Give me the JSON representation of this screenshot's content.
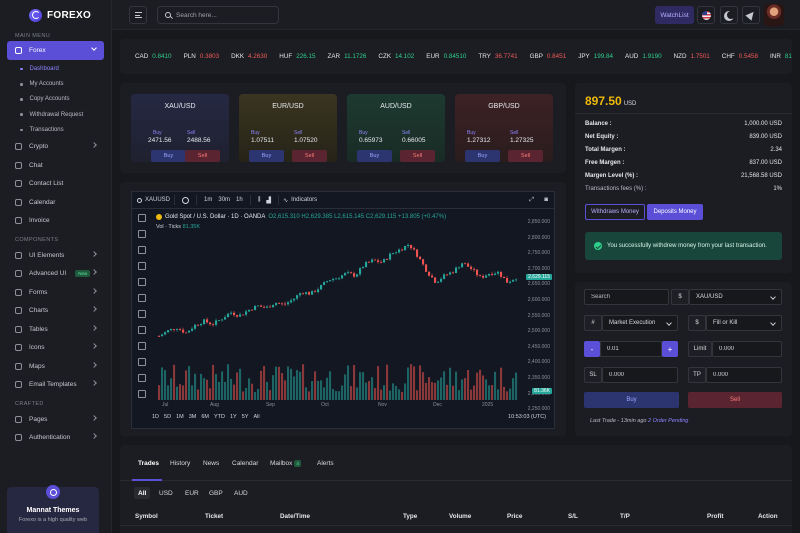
{
  "app": {
    "name": "FOREXO"
  },
  "header": {
    "search_placeholder": "Search here...",
    "watchlist_label": "WatchList"
  },
  "sidebar": {
    "main_menu_heading": "MAIN MENU",
    "forex_label": "Forex",
    "forex_sub": [
      "Dashboard",
      "My Accounts",
      "Copy Accounts",
      "Withdrawal Request",
      "Transactions"
    ],
    "crypto_label": "Crypto",
    "chat_label": "Chat",
    "contact_label": "Contact List",
    "calendar_label": "Calendar",
    "invoice_label": "Invoice",
    "components_heading": "COMPONENTS",
    "components": [
      "UI Elements",
      "Advanced UI",
      "Forms",
      "Charts",
      "Tables",
      "Icons",
      "Maps",
      "Email Templates"
    ],
    "new_badge": "New",
    "crafted_heading": "CRAFTED",
    "pages_label": "Pages",
    "auth_label": "Authentication",
    "promo_title": "Mannat Themes",
    "promo_text": "Forexo is a high quality web"
  },
  "ticker": [
    {
      "sym": "CAD",
      "val": "0.8410",
      "dir": "up"
    },
    {
      "sym": "PLN",
      "val": "0.3803",
      "dir": "down"
    },
    {
      "sym": "DKK",
      "val": "4.2630",
      "dir": "down"
    },
    {
      "sym": "HUF",
      "val": "226.15",
      "dir": "up"
    },
    {
      "sym": "ZAR",
      "val": "11.1726",
      "dir": "up"
    },
    {
      "sym": "CZK",
      "val": "14.102",
      "dir": "up"
    },
    {
      "sym": "EUR",
      "val": "0.84510",
      "dir": "up"
    },
    {
      "sym": "TRY",
      "val": "36.7741",
      "dir": "down"
    },
    {
      "sym": "GBP",
      "val": "0.8451",
      "dir": "down"
    },
    {
      "sym": "JPY",
      "val": "199.84",
      "dir": "up"
    },
    {
      "sym": "AUD",
      "val": "1.9190",
      "dir": "up"
    },
    {
      "sym": "NZD",
      "val": "1.7501",
      "dir": "down"
    },
    {
      "sym": "CHF",
      "val": "0.5458",
      "dir": "down"
    },
    {
      "sym": "INR",
      "val": "81.",
      "dir": "up"
    }
  ],
  "pairs": [
    {
      "name": "XAU/USD",
      "buy_label": "Buy",
      "sell_label": "Sell",
      "buy": "2471.56",
      "sell": "2488.56",
      "buy_btn": "Buy",
      "sell_btn": "Sell"
    },
    {
      "name": "EUR/USD",
      "buy_label": "Buy",
      "sell_label": "Sell",
      "buy": "1.07511",
      "sell": "1.07520",
      "buy_btn": "Buy",
      "sell_btn": "Sell"
    },
    {
      "name": "AUD/USD",
      "buy_label": "Buy",
      "sell_label": "Sell",
      "buy": "0.65973",
      "sell": "0.66005",
      "buy_btn": "Buy",
      "sell_btn": "Sell"
    },
    {
      "name": "GBP/USD",
      "buy_label": "Buy",
      "sell_label": "Sell",
      "buy": "1.27312",
      "sell": "1.27325",
      "buy_btn": "Buy",
      "sell_btn": "Sell"
    }
  ],
  "chart": {
    "symbol": "XAUUSD",
    "timeframes": [
      "1m",
      "30m",
      "1h"
    ],
    "indicators_label": "Indicators",
    "title": "Gold Spot / U.S. Dollar · 1D · OANDA",
    "ohlc": "O2,615.310 H2,629.385 L2,615.145 C2,629.115 +13.805 (+0.47%)",
    "vol_label": "Vol · Ticks",
    "vol_value": "81.35K",
    "ranges": [
      "1D",
      "5D",
      "1M",
      "3M",
      "6M",
      "YTD",
      "1Y",
      "5Y",
      "All"
    ],
    "time": "10:53:03 (UTC)",
    "months": [
      "Jul",
      "Aug",
      "Sep",
      "Oct",
      "Nov",
      "Dec",
      "2025"
    ],
    "price_ticks": [
      "2,850.000",
      "2,800.000",
      "2,750.000",
      "2,700.000",
      "2,650.000",
      "2,600.000",
      "2,550.000",
      "2,500.000",
      "2,450.000",
      "2,400.000",
      "2,350.000",
      "2,300.000",
      "2,250.000"
    ],
    "last_price": "2,629.115",
    "vol_tag": "81.36K"
  },
  "chart_data": {
    "type": "candlestick",
    "instrument": "XAUUSD",
    "x_range": [
      "Jul",
      "2025"
    ],
    "ylim": [
      2250,
      2850
    ],
    "close_path": [
      2360,
      2385,
      2400,
      2375,
      2410,
      2430,
      2415,
      2440,
      2470,
      2455,
      2480,
      2500,
      2490,
      2515,
      2505,
      2530,
      2565,
      2555,
      2585,
      2620,
      2630,
      2650,
      2640,
      2690,
      2710,
      2700,
      2740,
      2760,
      2785,
      2730,
      2660,
      2610,
      2640,
      2660,
      2700,
      2670,
      2630,
      2650,
      2655,
      2610,
      2630
    ]
  },
  "balance": {
    "amount": "897.50",
    "currency": "USD",
    "rows": [
      {
        "k": "Balance :",
        "v": "1,000.00 USD"
      },
      {
        "k": "Net Equity :",
        "v": "839.00 USD"
      },
      {
        "k": "Total Margen :",
        "v": "2.34"
      },
      {
        "k": "Free Margen :",
        "v": "837.00 USD"
      },
      {
        "k": "Margen Level (%) :",
        "v": "21,568.58 USD"
      },
      {
        "k": "Transactions fees (%) :",
        "v": "1%"
      }
    ],
    "withdraw_label": "Withdraws Money",
    "deposit_label": "Deposits Money",
    "success_msg": "You successfully withdrew money from your last transaction."
  },
  "order": {
    "search_placeholder": "Search",
    "pair_value": "XAU/USD",
    "hash_label": "#",
    "exec_value": "Market Execution",
    "dollar_label": "$",
    "fill_value": "Fill or Kill",
    "minus": "-",
    "qty": "0.01",
    "plus": "+",
    "limit_label": "Limit",
    "limit_value": "0.000",
    "sl_label": "SL",
    "sl_value": "0.000",
    "tp_label": "TP",
    "tp_value": "0.000",
    "buy_label": "Buy",
    "sell_label": "Sell",
    "last_trade": "Last Trade - 13min ago",
    "pending": "2 Order Pending"
  },
  "trades": {
    "tabs": [
      "Trades",
      "History",
      "News",
      "Calendar",
      "Mailbox",
      "Alerts"
    ],
    "mailbox_count": "4",
    "filters": [
      "All",
      "USD",
      "EUR",
      "GBP",
      "AUD"
    ],
    "columns": [
      "Symbol",
      "Ticket",
      "Date/Time",
      "Type",
      "Volume",
      "Price",
      "S/L",
      "T/P",
      "Profit",
      "Action"
    ]
  }
}
